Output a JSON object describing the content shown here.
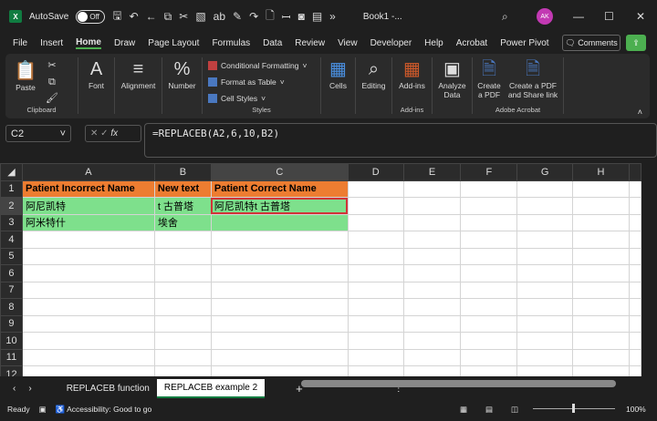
{
  "titlebar": {
    "autosave_label": "AutoSave",
    "autosave_state": "Off",
    "doc_title": "Book1 -...",
    "avatar": "AK"
  },
  "tabs": [
    "File",
    "Insert",
    "Home",
    "Draw",
    "Page Layout",
    "Formulas",
    "Data",
    "Review",
    "View",
    "Developer",
    "Help",
    "Acrobat",
    "Power Pivot"
  ],
  "active_tab": "Home",
  "comments_label": "Comments",
  "ribbon": {
    "clipboard": {
      "paste": "Paste",
      "label": "Clipboard"
    },
    "font": "Font",
    "alignment": "Alignment",
    "number": "Number",
    "styles": {
      "conditional": "Conditional Formatting",
      "format_table": "Format as Table",
      "cell_styles": "Cell Styles",
      "label": "Styles"
    },
    "cells": "Cells",
    "editing": "Editing",
    "addins": {
      "button": "Add-ins",
      "label": "Add-ins"
    },
    "analyze": "Analyze Data",
    "acrobat": {
      "create_pdf": "Create a PDF",
      "create_share": "Create a PDF and Share link",
      "label": "Adobe Acrobat"
    }
  },
  "formula_bar": {
    "name_box": "C2",
    "fx": "fx",
    "formula": "=REPLACEB(A2,6,10,B2)"
  },
  "grid": {
    "columns": [
      "A",
      "B",
      "C",
      "D",
      "E",
      "F",
      "G",
      "H"
    ],
    "rows": [
      [
        "Patient Incorrect Name",
        "New text",
        "Patient Correct Name",
        "",
        "",
        "",
        "",
        ""
      ],
      [
        "阿尼凯特",
        "t 古普塔",
        "阿尼凯特t 古普塔",
        "",
        "",
        "",
        "",
        ""
      ],
      [
        "阿米特什",
        "埃舍",
        "",
        "",
        "",
        "",
        "",
        ""
      ]
    ],
    "row_numbers": [
      "1",
      "2",
      "3",
      "4",
      "5",
      "6",
      "7",
      "8",
      "9",
      "10",
      "11",
      "12"
    ],
    "colors": {
      "header": "#ed7d31",
      "data": "#7ee08c",
      "selection": "#d13438"
    }
  },
  "sheets": [
    "REPLACEB function",
    "REPLACEB example 2"
  ],
  "active_sheet": "REPLACEB example 2",
  "status": {
    "ready": "Ready",
    "accessibility": "Accessibility: Good to go",
    "zoom": "100%"
  }
}
